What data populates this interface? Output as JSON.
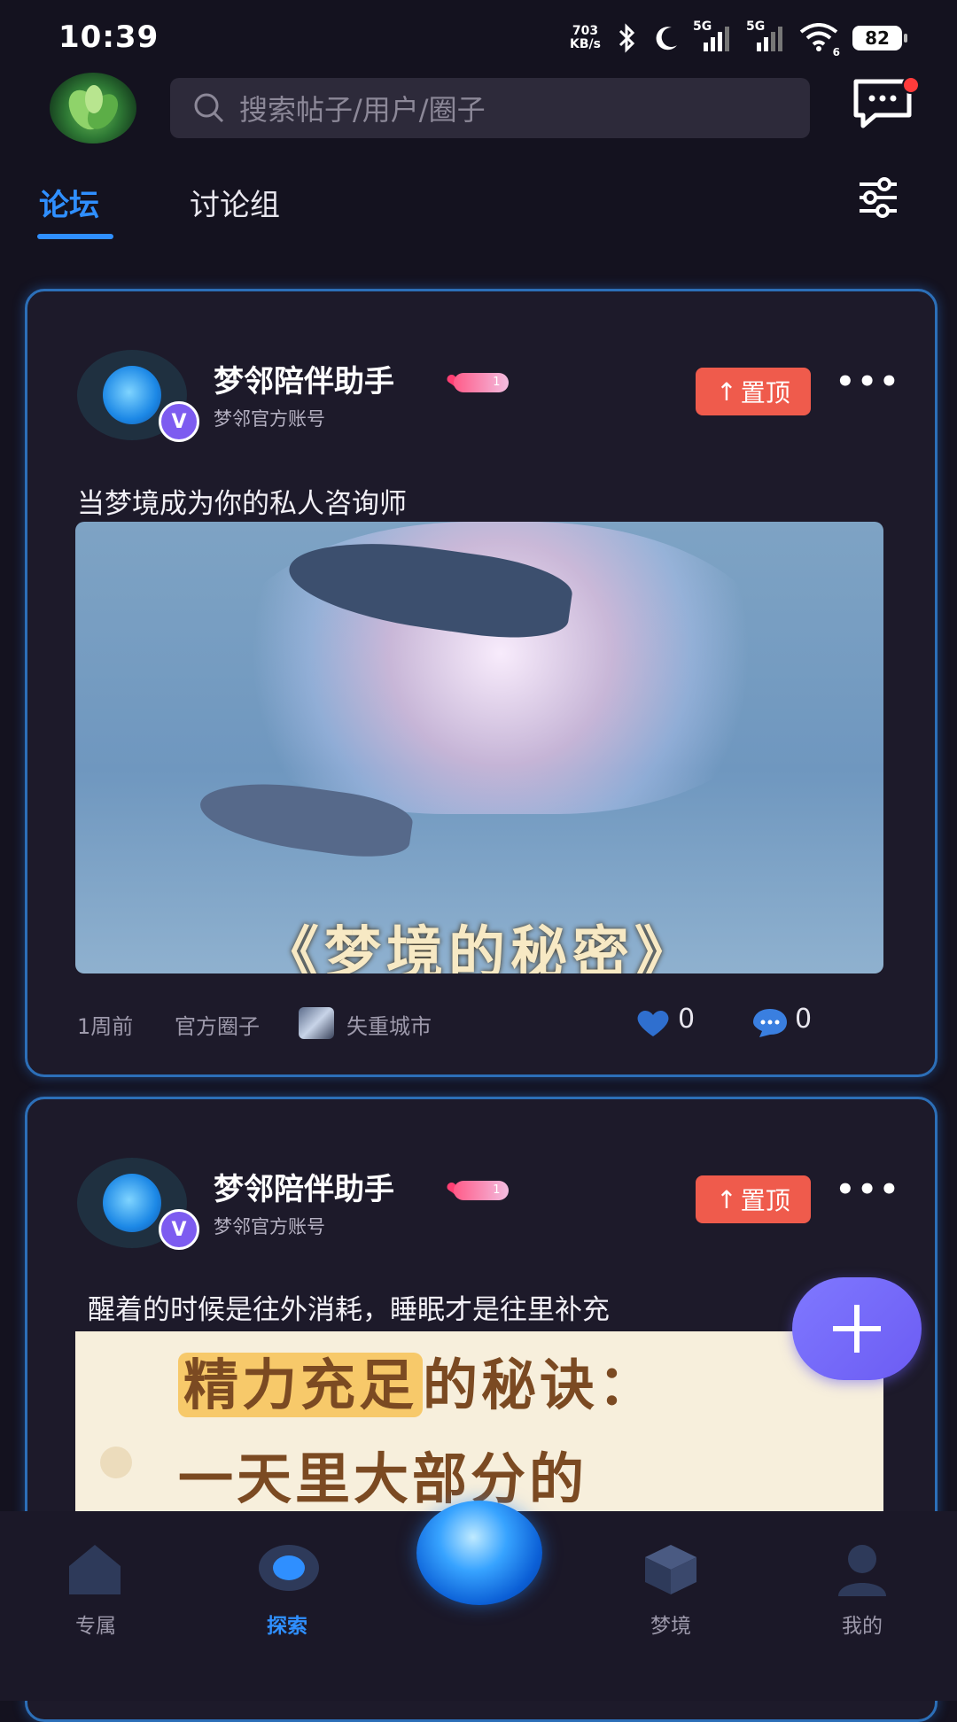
{
  "status_bar": {
    "time": "10:39",
    "net_speed_value": "703",
    "net_speed_unit": "KB/s",
    "signal1": "5G",
    "signal2": "5G",
    "wifi_sub": "6",
    "battery": "82"
  },
  "header": {
    "search_placeholder": "搜索帖子/用户/圈子",
    "has_unread_message": true
  },
  "tabs": [
    {
      "label": "论坛",
      "active": true
    },
    {
      "label": "讨论组",
      "active": false
    }
  ],
  "posts": [
    {
      "author": "梦邻陪伴助手",
      "level": "1",
      "subtitle": "梦邻官方账号",
      "verified_badge": "V",
      "pin_label": "置顶",
      "title": "当梦境成为你的私人咨询师",
      "image_caption": "《梦境的秘密》",
      "time": "1周前",
      "circle": "官方圈子",
      "city": "失重城市",
      "likes": "0",
      "comments": "0"
    },
    {
      "author": "梦邻陪伴助手",
      "level": "1",
      "subtitle": "梦邻官方账号",
      "verified_badge": "V",
      "pin_label": "置顶",
      "title": "醒着的时候是往外消耗，睡眠才是往里补充",
      "image_line1_highlight": "精力充足",
      "image_line1_rest": "的秘诀：",
      "image_line2": "一天里大部分的"
    }
  ],
  "fab": {
    "icon": "plus-icon"
  },
  "bottom_nav": [
    {
      "label": "专属",
      "icon": "home-icon",
      "active": false
    },
    {
      "label": "探索",
      "icon": "explore-icon",
      "active": true
    },
    {
      "label": "",
      "icon": "dream-orb-icon",
      "active": false
    },
    {
      "label": "梦境",
      "icon": "cube-icon",
      "active": false
    },
    {
      "label": "我的",
      "icon": "profile-icon",
      "active": false
    }
  ],
  "colors": {
    "background": "#14121f",
    "accent": "#2f8fff",
    "pin": "#ef5b4c",
    "fab": "#6c5cf3",
    "card_border": "#2c6fb8"
  }
}
